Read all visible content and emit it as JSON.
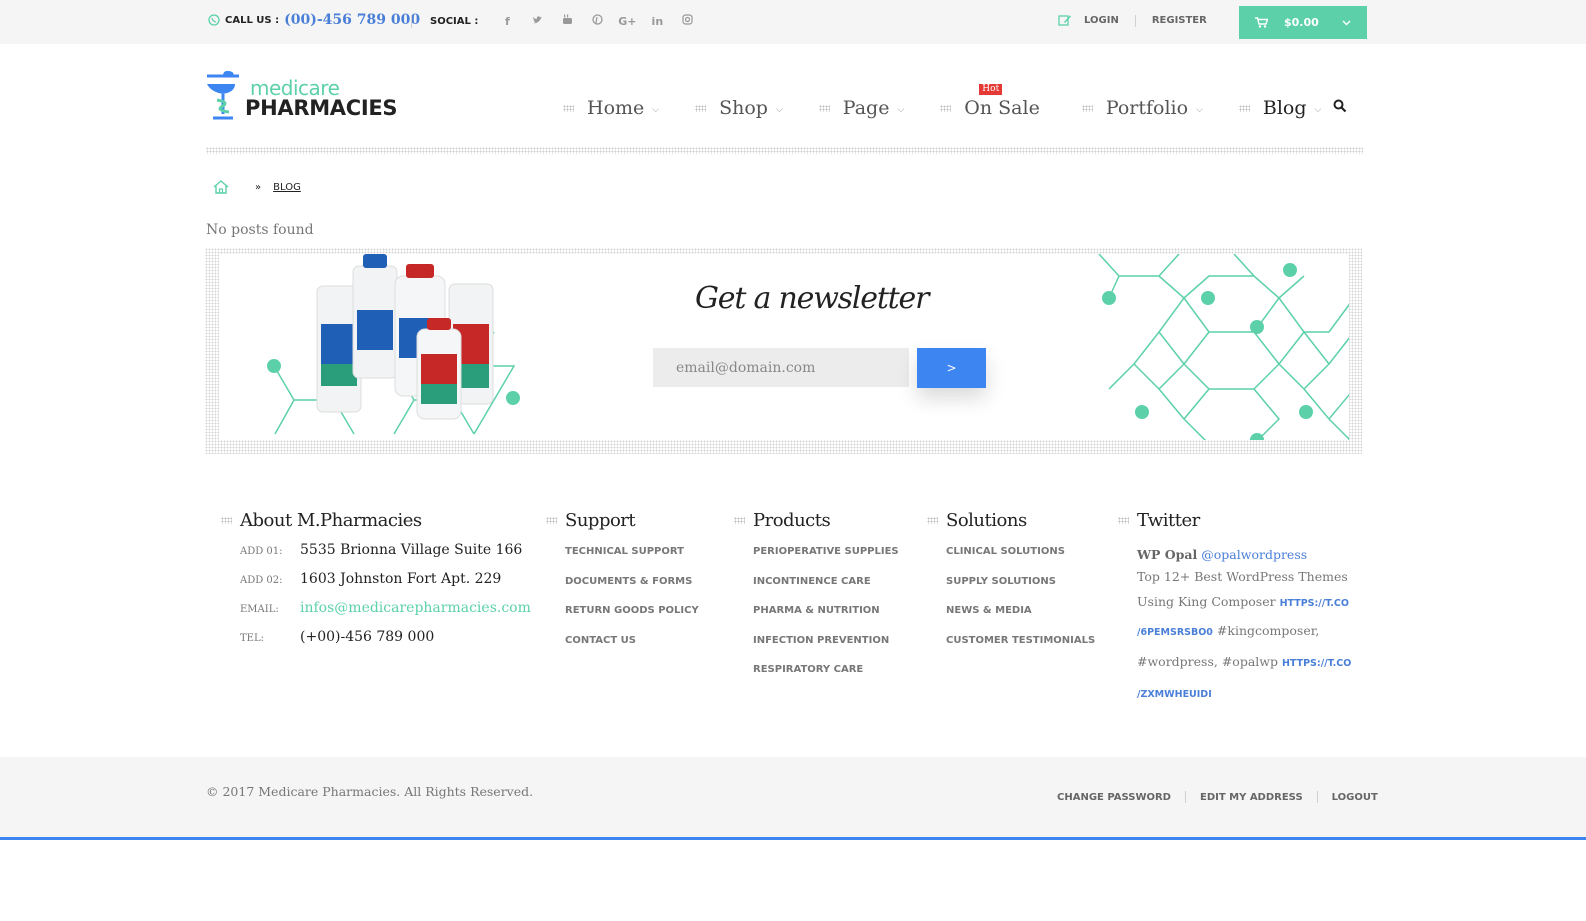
{
  "topbar": {
    "call_label": "CALL US :",
    "phone": "(00)-456 789 000",
    "social_label": "SOCIAL :",
    "social_icons": [
      "facebook-icon",
      "twitter-icon",
      "youtube-icon",
      "pinterest-icon",
      "google-plus-icon",
      "linkedin-icon",
      "instagram-icon"
    ],
    "login": "LOGIN",
    "register": "REGISTER",
    "cart_amount": "$0.00"
  },
  "logo": {
    "line1": "medicare",
    "line2": "PHARMACIES"
  },
  "nav": {
    "items": [
      {
        "label": "Home"
      },
      {
        "label": "Shop"
      },
      {
        "label": "Page"
      },
      {
        "label": "On Sale",
        "badge": "Hot"
      },
      {
        "label": "Portfolio"
      },
      {
        "label": "Blog"
      }
    ]
  },
  "breadcrumb": {
    "separator": "»",
    "current": "BLOG"
  },
  "main": {
    "no_posts": "No posts found"
  },
  "newsletter": {
    "title": "Get a newsletter",
    "placeholder": "email@domain.com",
    "button": ">"
  },
  "footer": {
    "about": {
      "title": "About M.Pharmacies",
      "rows": [
        {
          "key": "ADD 01:",
          "value": "5535 Brionna Village Suite 166"
        },
        {
          "key": "ADD 02:",
          "value": "1603 Johnston Fort Apt. 229"
        },
        {
          "key": "EMAIL:",
          "value": "infos@medicarepharmacies.com"
        },
        {
          "key": "TEL:",
          "value": "(+00)-456 789 000"
        }
      ]
    },
    "support": {
      "title": "Support",
      "links": [
        "TECHNICAL SUPPORT",
        "DOCUMENTS & FORMS",
        "RETURN GOODS POLICY",
        "CONTACT US"
      ]
    },
    "products": {
      "title": "Products",
      "links": [
        "PERIOPERATIVE SUPPLIES",
        "INCONTINENCE CARE",
        "PHARMA & NUTRITION",
        "INFECTION PREVENTION",
        "RESPIRATORY CARE"
      ]
    },
    "solutions": {
      "title": "Solutions",
      "links": [
        "CLINICAL SOLUTIONS",
        "SUPPLY SOLUTIONS",
        "NEWS & MEDIA",
        "CUSTOMER TESTIMONIALS"
      ]
    },
    "twitter": {
      "title": "Twitter",
      "user": "WP Opal",
      "handle": "@opalwordpress",
      "text1": "Top 12+ Best WordPress Themes Using King Composer",
      "link1a": "HTTPS://T.CO",
      "link1b": "/6PEMSRSBO0",
      "text2": "#kingcomposer,",
      "text3": "#wordpress, #opalwp",
      "link2a": "HTTPS://T.CO",
      "link2b": "/ZXMWHEUIDI"
    }
  },
  "bottom": {
    "copyright": "© 2017 Medicare Pharmacies. All Rights Reserved.",
    "links": [
      "CHANGE PASSWORD",
      "EDIT MY ADDRESS",
      "LOGOUT"
    ]
  },
  "colors": {
    "accent": "#5cd1a9",
    "blue": "#3d85f0",
    "link": "#4a7fd8",
    "hot": "#e53935"
  }
}
